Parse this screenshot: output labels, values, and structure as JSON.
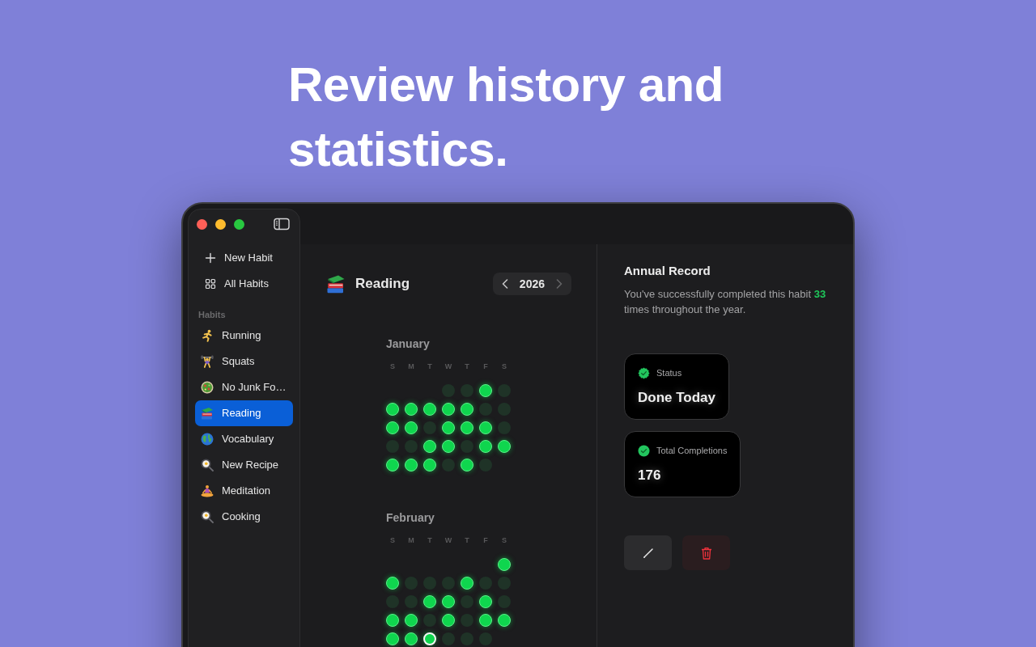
{
  "headline": "Review history and statistics.",
  "sidebar": {
    "actions": [
      {
        "label": "New Habit"
      },
      {
        "label": "All Habits"
      }
    ],
    "section_label": "Habits",
    "habits": [
      {
        "label": "Running",
        "selected": false
      },
      {
        "label": "Squats",
        "selected": false
      },
      {
        "label": "No Junk Fo…",
        "selected": false
      },
      {
        "label": "Reading",
        "selected": true
      },
      {
        "label": "Vocabulary",
        "selected": false
      },
      {
        "label": "New Recipe",
        "selected": false
      },
      {
        "label": "Meditation",
        "selected": false
      },
      {
        "label": "Cooking",
        "selected": false
      }
    ]
  },
  "habit": {
    "title": "Reading",
    "year_nav": {
      "year": "2026",
      "prev_disabled": false,
      "next_disabled": true
    },
    "months": [
      {
        "name": "January",
        "weekdays": [
          "S",
          "M",
          "T",
          "W",
          "T",
          "F",
          "S"
        ],
        "weeks": [
          [
            {
              "kind": "blank"
            },
            {
              "kind": "blank"
            },
            {
              "kind": "blank"
            },
            {
              "kind": "day",
              "done": false,
              "today": false
            },
            {
              "kind": "day",
              "done": false,
              "today": false
            },
            {
              "kind": "day",
              "done": true,
              "today": false
            },
            {
              "kind": "day",
              "done": false,
              "today": false
            }
          ],
          [
            {
              "kind": "day",
              "done": true,
              "today": false
            },
            {
              "kind": "day",
              "done": true,
              "today": false
            },
            {
              "kind": "day",
              "done": true,
              "today": false
            },
            {
              "kind": "day",
              "done": true,
              "today": false
            },
            {
              "kind": "day",
              "done": true,
              "today": false
            },
            {
              "kind": "day",
              "done": false,
              "today": false
            },
            {
              "kind": "day",
              "done": false,
              "today": false
            }
          ],
          [
            {
              "kind": "day",
              "done": true,
              "today": false
            },
            {
              "kind": "day",
              "done": true,
              "today": false
            },
            {
              "kind": "day",
              "done": false,
              "today": false
            },
            {
              "kind": "day",
              "done": true,
              "today": false
            },
            {
              "kind": "day",
              "done": true,
              "today": false
            },
            {
              "kind": "day",
              "done": true,
              "today": false
            },
            {
              "kind": "day",
              "done": false,
              "today": false
            }
          ],
          [
            {
              "kind": "day",
              "done": false,
              "today": false
            },
            {
              "kind": "day",
              "done": false,
              "today": false
            },
            {
              "kind": "day",
              "done": true,
              "today": false
            },
            {
              "kind": "day",
              "done": true,
              "today": false
            },
            {
              "kind": "day",
              "done": false,
              "today": false
            },
            {
              "kind": "day",
              "done": true,
              "today": false
            },
            {
              "kind": "day",
              "done": true,
              "today": false
            }
          ],
          [
            {
              "kind": "day",
              "done": true,
              "today": false
            },
            {
              "kind": "day",
              "done": true,
              "today": false
            },
            {
              "kind": "day",
              "done": true,
              "today": false
            },
            {
              "kind": "day",
              "done": false,
              "today": false
            },
            {
              "kind": "day",
              "done": true,
              "today": false
            },
            {
              "kind": "day",
              "done": false,
              "today": false
            }
          ]
        ]
      },
      {
        "name": "February",
        "weekdays": [
          "S",
          "M",
          "T",
          "W",
          "T",
          "F",
          "S"
        ],
        "weeks": [
          [
            {
              "kind": "blank"
            },
            {
              "kind": "blank"
            },
            {
              "kind": "blank"
            },
            {
              "kind": "blank"
            },
            {
              "kind": "blank"
            },
            {
              "kind": "blank"
            },
            {
              "kind": "day",
              "done": true,
              "today": false
            }
          ],
          [
            {
              "kind": "day",
              "done": true,
              "today": false
            },
            {
              "kind": "day",
              "done": false,
              "today": false
            },
            {
              "kind": "day",
              "done": false,
              "today": false
            },
            {
              "kind": "day",
              "done": false,
              "today": false
            },
            {
              "kind": "day",
              "done": true,
              "today": false
            },
            {
              "kind": "day",
              "done": false,
              "today": false
            },
            {
              "kind": "day",
              "done": false,
              "today": false
            }
          ],
          [
            {
              "kind": "day",
              "done": false,
              "today": false
            },
            {
              "kind": "day",
              "done": false,
              "today": false
            },
            {
              "kind": "day",
              "done": true,
              "today": false
            },
            {
              "kind": "day",
              "done": true,
              "today": false
            },
            {
              "kind": "day",
              "done": false,
              "today": false
            },
            {
              "kind": "day",
              "done": true,
              "today": false
            },
            {
              "kind": "day",
              "done": false,
              "today": false
            }
          ],
          [
            {
              "kind": "day",
              "done": true,
              "today": false
            },
            {
              "kind": "day",
              "done": true,
              "today": false
            },
            {
              "kind": "day",
              "done": false,
              "today": false
            },
            {
              "kind": "day",
              "done": true,
              "today": false
            },
            {
              "kind": "day",
              "done": false,
              "today": false
            },
            {
              "kind": "day",
              "done": true,
              "today": false
            },
            {
              "kind": "day",
              "done": true,
              "today": false
            }
          ],
          [
            {
              "kind": "day",
              "done": true,
              "today": false
            },
            {
              "kind": "day",
              "done": true,
              "today": false
            },
            {
              "kind": "day",
              "done": true,
              "today": true
            },
            {
              "kind": "day",
              "done": false,
              "today": false
            },
            {
              "kind": "day",
              "done": false,
              "today": false
            },
            {
              "kind": "day",
              "done": false,
              "today": false
            }
          ]
        ]
      }
    ]
  },
  "annual_record": {
    "title": "Annual Record",
    "text": "You've successfully completed this habit **33** times throughout the year."
  },
  "stats": [
    {
      "kind": "status",
      "label": "Status",
      "value": "Done Today"
    },
    {
      "kind": "count",
      "label": "Total Completions",
      "value": "176"
    }
  ],
  "buttons": [
    {
      "kind": "edit"
    },
    {
      "kind": "delete"
    }
  ]
}
